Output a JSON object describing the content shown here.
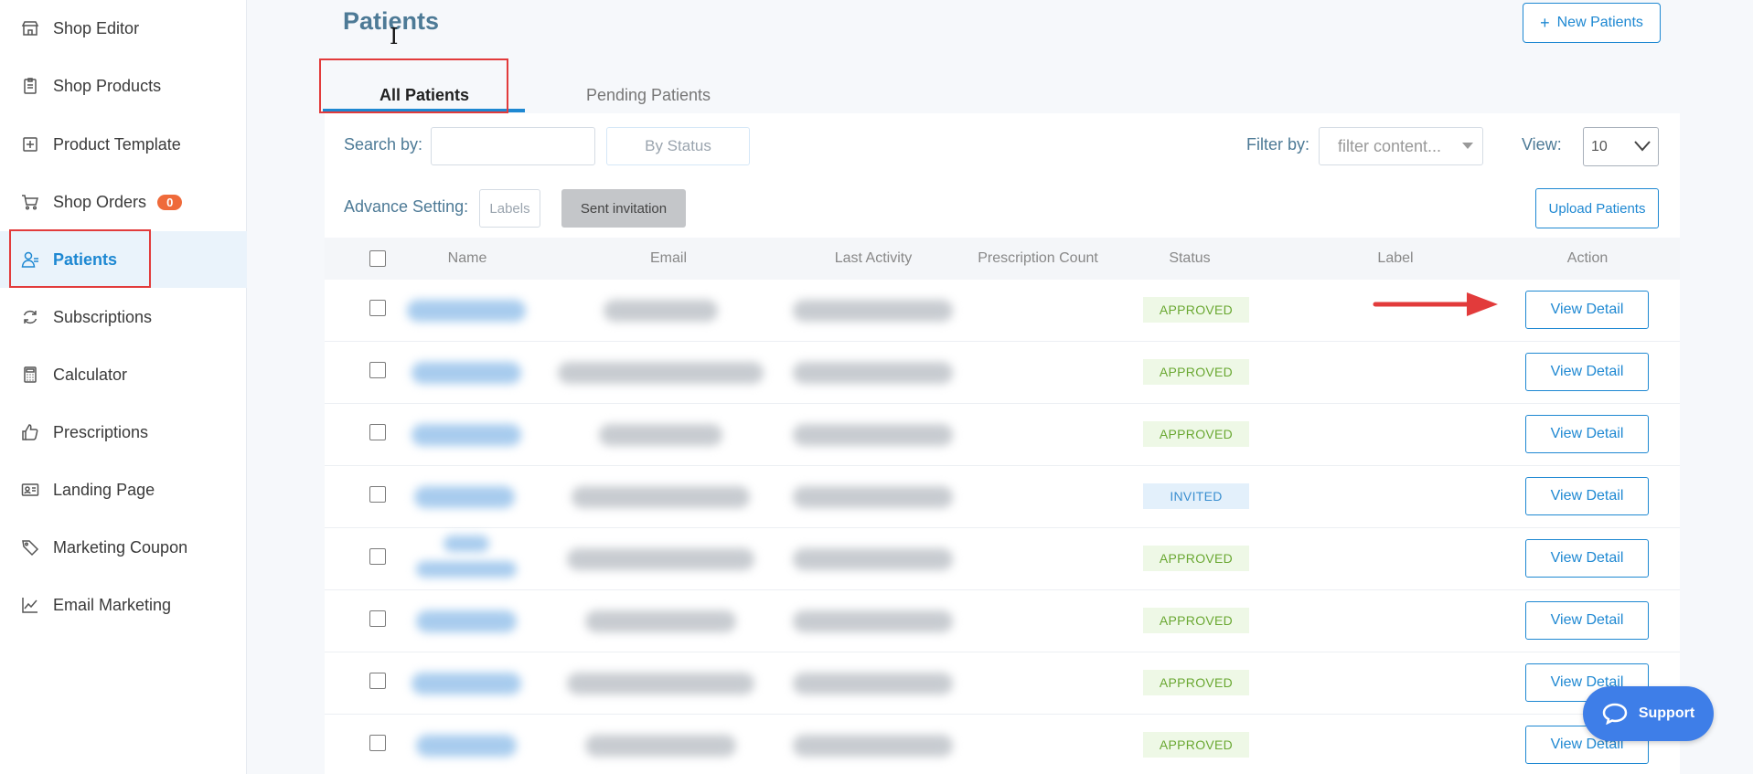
{
  "sidebar": {
    "items": [
      {
        "label": "Shop Editor",
        "icon": "store-icon"
      },
      {
        "label": "Shop Products",
        "icon": "clipboard-icon"
      },
      {
        "label": "Product Template",
        "icon": "plus-box-icon"
      },
      {
        "label": "Shop Orders",
        "icon": "cart-icon",
        "badge": "0"
      },
      {
        "label": "Patients",
        "icon": "users-icon",
        "active": true
      },
      {
        "label": "Subscriptions",
        "icon": "refresh-icon"
      },
      {
        "label": "Calculator",
        "icon": "calculator-icon"
      },
      {
        "label": "Prescriptions",
        "icon": "thumbs-up-icon"
      },
      {
        "label": "Landing Page",
        "icon": "id-card-icon"
      },
      {
        "label": "Marketing Coupon",
        "icon": "tag-icon"
      },
      {
        "label": "Email Marketing",
        "icon": "chart-line-icon"
      }
    ]
  },
  "header": {
    "title": "Patients",
    "new_button": "New Patients",
    "new_button_icon": "+"
  },
  "tabs": [
    {
      "label": "All Patients",
      "active": true
    },
    {
      "label": "Pending Patients"
    }
  ],
  "filters": {
    "search_label": "Search by:",
    "search_value": "",
    "status_button": "By Status",
    "filter_label": "Filter by:",
    "filter_placeholder": "filter content...",
    "view_label": "View:",
    "view_value": "10",
    "advance_label": "Advance Setting:",
    "labels_button": "Labels",
    "sent_invitation_button": "Sent invitation",
    "upload_button": "Upload Patients"
  },
  "table": {
    "columns": [
      "Name",
      "Email",
      "Last Activity",
      "Prescription Count",
      "Status",
      "Label",
      "Action"
    ],
    "rows": [
      {
        "status": "APPROVED",
        "action": "View Detail"
      },
      {
        "status": "APPROVED",
        "action": "View Detail"
      },
      {
        "status": "APPROVED",
        "action": "View Detail"
      },
      {
        "status": "INVITED",
        "action": "View Detail"
      },
      {
        "status": "APPROVED",
        "action": "View Detail"
      },
      {
        "status": "APPROVED",
        "action": "View Detail"
      },
      {
        "status": "APPROVED",
        "action": "View Detail"
      },
      {
        "status": "APPROVED",
        "action": "View Detail"
      }
    ]
  },
  "support": {
    "label": "Support"
  },
  "colors": {
    "accent": "#1e88d2",
    "title": "#4d7a96",
    "highlight": "#e23b3b",
    "badge": "#ef6a3a",
    "approved": "#6aa832",
    "invited": "#3a8fd0",
    "support": "#3e7ee8"
  }
}
